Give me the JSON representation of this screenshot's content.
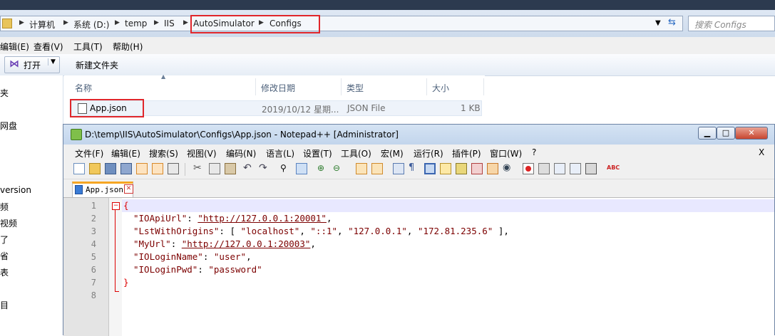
{
  "explorer": {
    "breadcrumb": [
      "计算机",
      "系统 (D:)",
      "temp",
      "IIS",
      "AutoSimulator",
      "Configs"
    ],
    "search_placeholder": "搜索 Configs",
    "menu": [
      "编辑(E)",
      "查看(V)",
      "工具(T)",
      "帮助(H)"
    ],
    "toolbar": {
      "open": "打开",
      "new_folder": "新建文件夹"
    },
    "nav_items": [
      "夹",
      "网盘",
      "version",
      "频",
      "视频",
      "了",
      "省",
      "表",
      "目"
    ],
    "columns": [
      "名称",
      "修改日期",
      "类型",
      "大小"
    ],
    "file": {
      "name": "App.json",
      "date": "2019/10/12 星期...",
      "type": "JSON File",
      "size": "1 KB"
    }
  },
  "notepad": {
    "title": "D:\\temp\\IIS\\AutoSimulator\\Configs\\App.json - Notepad++ [Administrator]",
    "menu": [
      "文件(F)",
      "编辑(E)",
      "搜索(S)",
      "视图(V)",
      "编码(N)",
      "语言(L)",
      "设置(T)",
      "工具(O)",
      "宏(M)",
      "运行(R)",
      "插件(P)",
      "窗口(W)",
      "?"
    ],
    "close_x": "X",
    "tab": "App.json",
    "line_numbers": [
      "1",
      "2",
      "3",
      "4",
      "5",
      "6",
      "7",
      "8"
    ],
    "code": {
      "l1": "{",
      "l2k": "\"IOApiUrl\"",
      "l2v": "\"http://127.0.0.1:20001\"",
      "l3k": "\"LstWithOrigins\"",
      "l3a": "\"localhost\"",
      "l3b": "\"::1\"",
      "l3c": "\"127.0.0.1\"",
      "l3d": "\"172.81.235.6\"",
      "l4k": "\"MyUrl\"",
      "l4v": "\"http://127.0.0.1:20003\"",
      "l5k": "\"IOLoginName\"",
      "l5v": "\"user\"",
      "l6k": "\"IOLoginPwd\"",
      "l6v": "\"password\"",
      "l7": "}"
    }
  }
}
